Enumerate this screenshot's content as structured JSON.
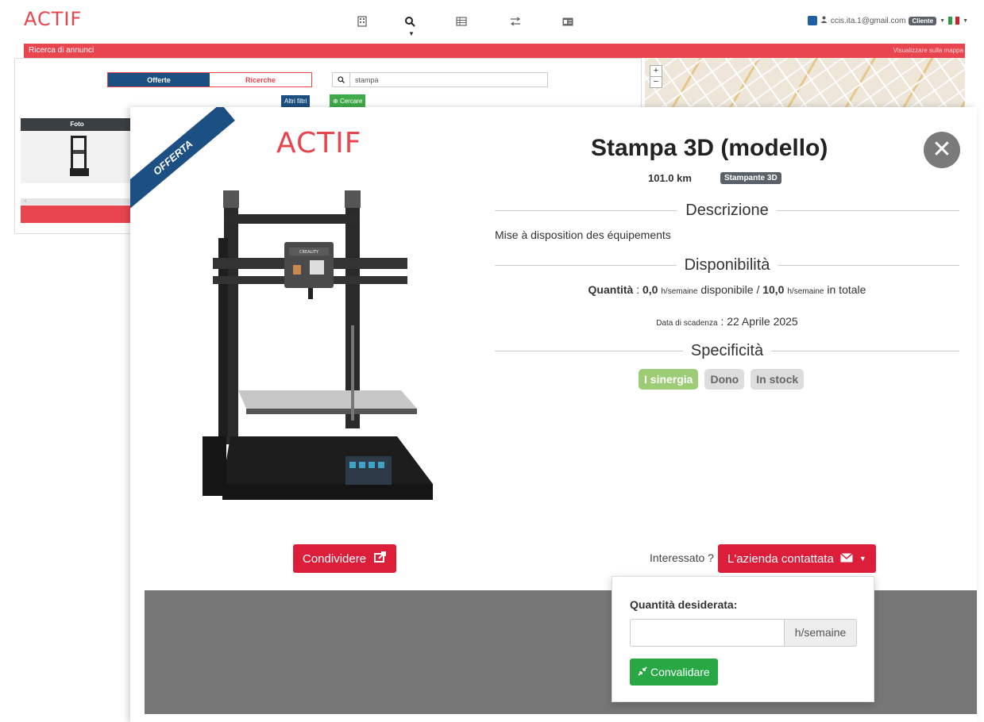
{
  "brand": {
    "logo_text": "ACTIF",
    "accent": "#e8454e"
  },
  "nav": {
    "icons": [
      "building-icon",
      "search-icon",
      "list-icon",
      "exchange-icon",
      "id-card-icon"
    ],
    "user": {
      "email": "ccis.ita.1@gmail.com",
      "role_badge": "Cliente",
      "language_flag": "italian-flag-icon"
    }
  },
  "subheader": {
    "title": "Ricerca di annunci",
    "map_link": "Visualizzare sulla mappa"
  },
  "background_search": {
    "tabs": [
      "Offerte",
      "Ricerche"
    ],
    "active_tab": "Offerte",
    "search_value": "stampa",
    "more_filters": "Altri filtri",
    "search_button": "Cercare",
    "table_header": "Foto"
  },
  "modal": {
    "ribbon": "OFFERTA",
    "title": "Stampa 3D (modello)",
    "distance": "101.0 km",
    "category": "Stampante 3D",
    "description_heading": "Descrizione",
    "description": "Mise à disposition des équipements",
    "availability_heading": "Disponibilità",
    "quantity": {
      "label": "Quantità",
      "available_value": "0,0",
      "unit": "h/semaine",
      "available_text": "disponibile /",
      "total_value": "10,0",
      "total_text": "in totale"
    },
    "expiry": {
      "label": "Data di scadenza",
      "value": "22 Aprile 2025"
    },
    "specificity_heading": "Specificità",
    "tags": [
      "I sinergia",
      "Dono",
      "In stock"
    ],
    "share_button": "Condividere",
    "interested_label": "Interessato ?",
    "contact_button": "L'azienda contattata"
  },
  "popover": {
    "quantity_label": "Quantità desiderata:",
    "quantity_value": "",
    "unit": "h/semaine",
    "validate_button": "Convalidare"
  },
  "printer_screen_brand": "CREALITY"
}
